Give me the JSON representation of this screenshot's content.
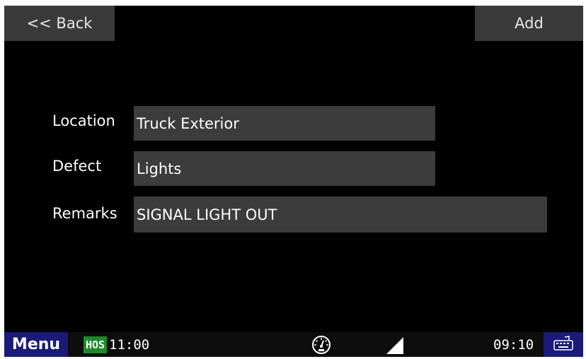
{
  "toolbar": {
    "back_label": "<< Back",
    "add_label": "Add"
  },
  "form": {
    "location": {
      "label": "Location",
      "value": "Truck Exterior"
    },
    "defect": {
      "label": "Defect",
      "value": "Lights"
    },
    "remarks": {
      "label": "Remarks",
      "value": "SIGNAL LIGHT OUT"
    }
  },
  "statusbar": {
    "menu_label": "Menu",
    "hos_badge": "HOS",
    "hos_time": "11:00",
    "clock": "09:10",
    "icons": [
      "gauge-icon",
      "signal-icon",
      "keyboard-icon"
    ]
  },
  "colors": {
    "background": "#000000",
    "button_bg": "#3a3a3a",
    "field_bg": "#3c3c3c",
    "menu_bg": "#1a1a78",
    "hos_green": "#1f8a2a"
  }
}
